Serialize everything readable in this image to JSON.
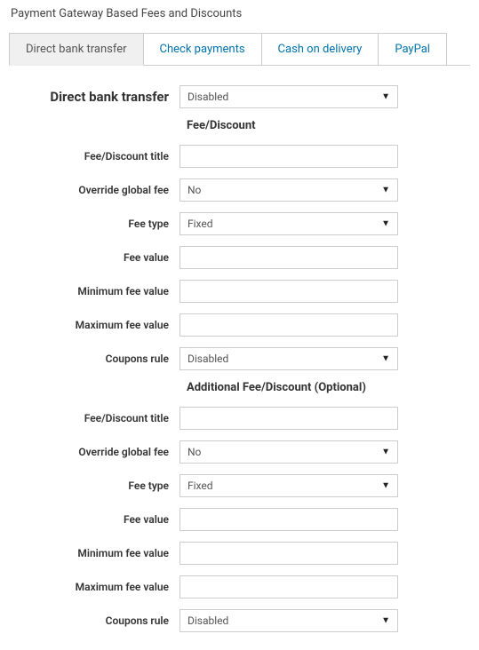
{
  "page_title": "Payment Gateway Based Fees and Discounts",
  "tabs": [
    {
      "label": "Direct bank transfer",
      "active": true
    },
    {
      "label": "Check payments",
      "active": false
    },
    {
      "label": "Cash on delivery",
      "active": false
    },
    {
      "label": "PayPal",
      "active": false
    }
  ],
  "heading_label": "Direct bank transfer",
  "heading_value": "Disabled",
  "section1_title": "Fee/Discount",
  "section2_title": "Additional Fee/Discount (Optional)",
  "fields": {
    "title_label": "Fee/Discount title",
    "override_label": "Override global fee",
    "type_label": "Fee type",
    "value_label": "Fee value",
    "min_label": "Minimum fee value",
    "max_label": "Maximum fee value",
    "coupons_label": "Coupons rule"
  },
  "section1": {
    "title": "",
    "override": "No",
    "type": "Fixed",
    "value": "",
    "min": "",
    "max": "",
    "coupons": "Disabled"
  },
  "section2": {
    "title": "",
    "override": "No",
    "type": "Fixed",
    "value": "",
    "min": "",
    "max": "",
    "coupons": "Disabled"
  }
}
